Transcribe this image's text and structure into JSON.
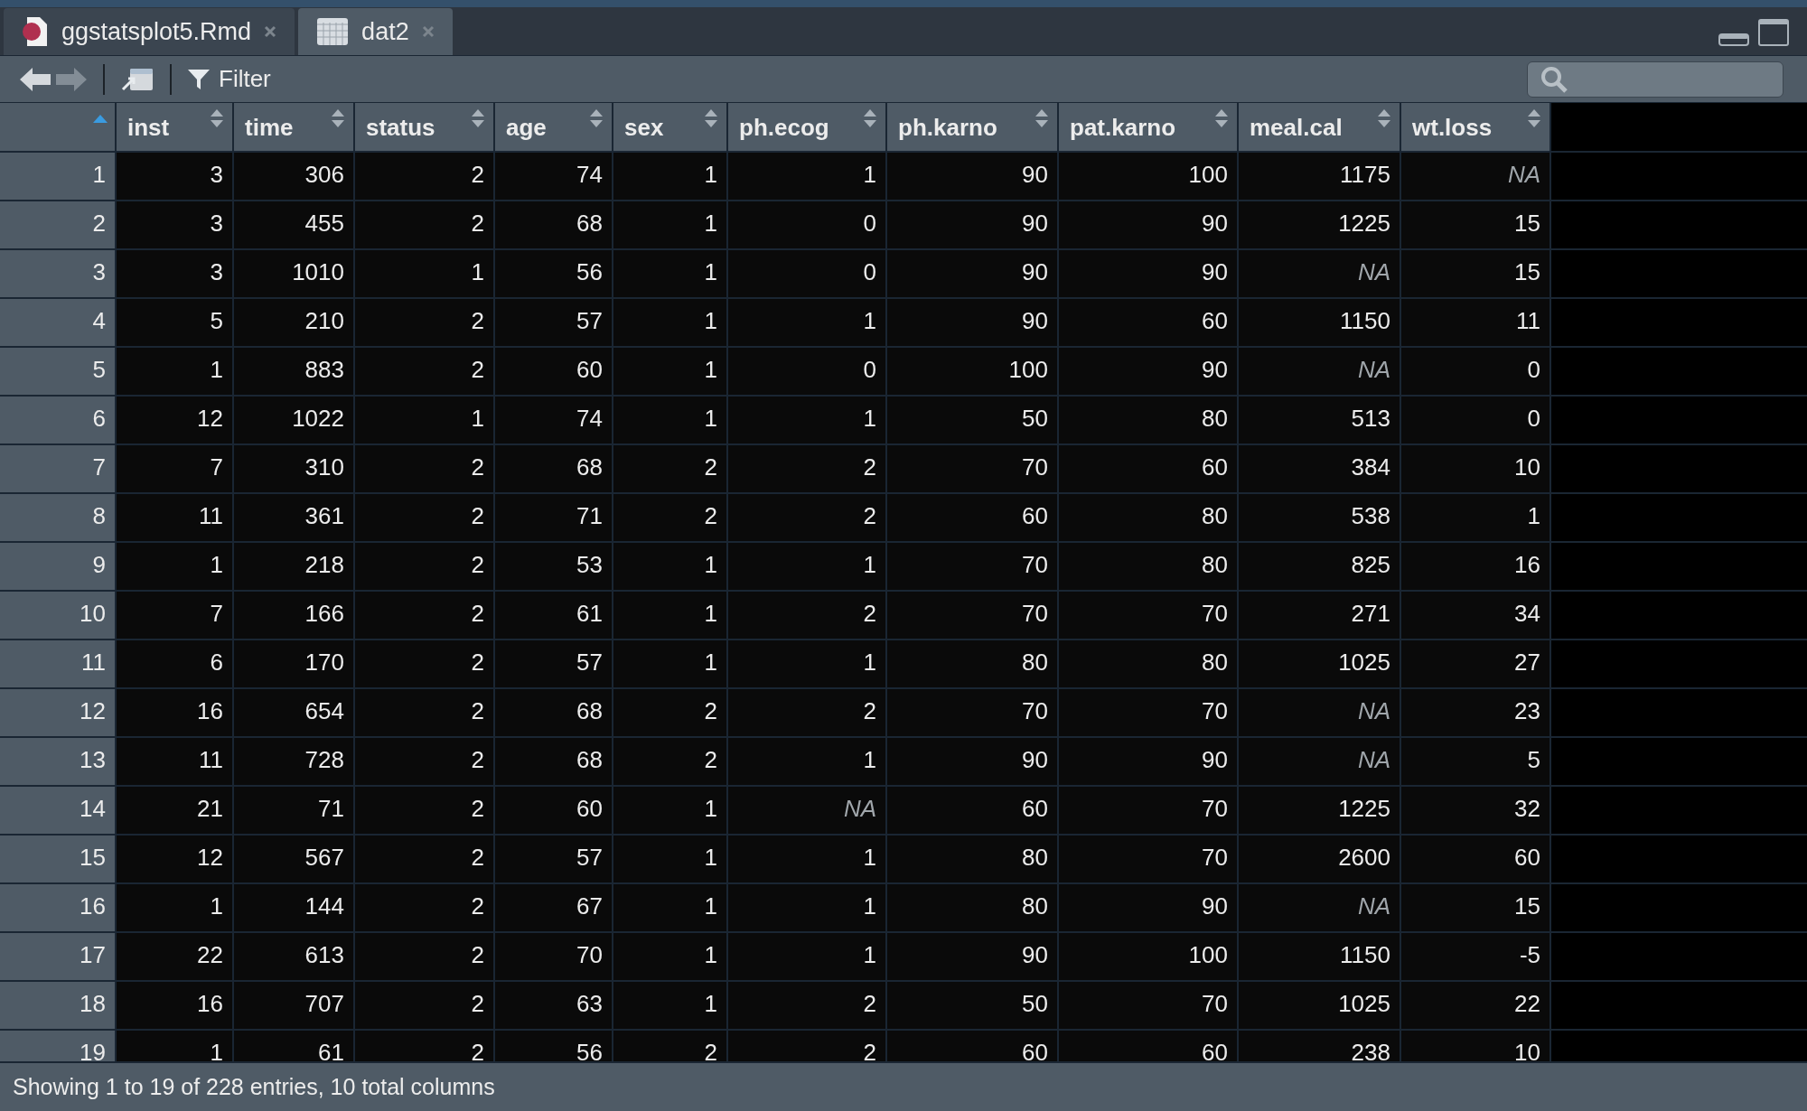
{
  "tabs": [
    {
      "label": "ggstatsplot5.Rmd",
      "kind": "rmd",
      "selected": false
    },
    {
      "label": "dat2",
      "kind": "data",
      "selected": true
    }
  ],
  "toolbar": {
    "filter_label": "Filter"
  },
  "table": {
    "index_header": {
      "sorted": true
    },
    "columns": [
      {
        "label": "inst",
        "sorted": false
      },
      {
        "label": "time",
        "sorted": false
      },
      {
        "label": "status",
        "sorted": false
      },
      {
        "label": "age",
        "sorted": false
      },
      {
        "label": "sex",
        "sorted": false
      },
      {
        "label": "ph.ecog",
        "sorted": false
      },
      {
        "label": "ph.karno",
        "sorted": false
      },
      {
        "label": "pat.karno",
        "sorted": false
      },
      {
        "label": "meal.cal",
        "sorted": false
      },
      {
        "label": "wt.loss",
        "sorted": false
      }
    ],
    "rows": [
      {
        "n": "1",
        "cells": [
          "3",
          "306",
          "2",
          "74",
          "1",
          "1",
          "90",
          "100",
          "1175",
          "NA"
        ],
        "missing": [
          false,
          false,
          false,
          false,
          false,
          false,
          false,
          false,
          false,
          true
        ]
      },
      {
        "n": "2",
        "cells": [
          "3",
          "455",
          "2",
          "68",
          "1",
          "0",
          "90",
          "90",
          "1225",
          "15"
        ],
        "missing": [
          false,
          false,
          false,
          false,
          false,
          false,
          false,
          false,
          false,
          false
        ]
      },
      {
        "n": "3",
        "cells": [
          "3",
          "1010",
          "1",
          "56",
          "1",
          "0",
          "90",
          "90",
          "NA",
          "15"
        ],
        "missing": [
          false,
          false,
          false,
          false,
          false,
          false,
          false,
          false,
          true,
          false
        ]
      },
      {
        "n": "4",
        "cells": [
          "5",
          "210",
          "2",
          "57",
          "1",
          "1",
          "90",
          "60",
          "1150",
          "11"
        ],
        "missing": [
          false,
          false,
          false,
          false,
          false,
          false,
          false,
          false,
          false,
          false
        ]
      },
      {
        "n": "5",
        "cells": [
          "1",
          "883",
          "2",
          "60",
          "1",
          "0",
          "100",
          "90",
          "NA",
          "0"
        ],
        "missing": [
          false,
          false,
          false,
          false,
          false,
          false,
          false,
          false,
          true,
          false
        ]
      },
      {
        "n": "6",
        "cells": [
          "12",
          "1022",
          "1",
          "74",
          "1",
          "1",
          "50",
          "80",
          "513",
          "0"
        ],
        "missing": [
          false,
          false,
          false,
          false,
          false,
          false,
          false,
          false,
          false,
          false
        ]
      },
      {
        "n": "7",
        "cells": [
          "7",
          "310",
          "2",
          "68",
          "2",
          "2",
          "70",
          "60",
          "384",
          "10"
        ],
        "missing": [
          false,
          false,
          false,
          false,
          false,
          false,
          false,
          false,
          false,
          false
        ]
      },
      {
        "n": "8",
        "cells": [
          "11",
          "361",
          "2",
          "71",
          "2",
          "2",
          "60",
          "80",
          "538",
          "1"
        ],
        "missing": [
          false,
          false,
          false,
          false,
          false,
          false,
          false,
          false,
          false,
          false
        ]
      },
      {
        "n": "9",
        "cells": [
          "1",
          "218",
          "2",
          "53",
          "1",
          "1",
          "70",
          "80",
          "825",
          "16"
        ],
        "missing": [
          false,
          false,
          false,
          false,
          false,
          false,
          false,
          false,
          false,
          false
        ]
      },
      {
        "n": "10",
        "cells": [
          "7",
          "166",
          "2",
          "61",
          "1",
          "2",
          "70",
          "70",
          "271",
          "34"
        ],
        "missing": [
          false,
          false,
          false,
          false,
          false,
          false,
          false,
          false,
          false,
          false
        ]
      },
      {
        "n": "11",
        "cells": [
          "6",
          "170",
          "2",
          "57",
          "1",
          "1",
          "80",
          "80",
          "1025",
          "27"
        ],
        "missing": [
          false,
          false,
          false,
          false,
          false,
          false,
          false,
          false,
          false,
          false
        ]
      },
      {
        "n": "12",
        "cells": [
          "16",
          "654",
          "2",
          "68",
          "2",
          "2",
          "70",
          "70",
          "NA",
          "23"
        ],
        "missing": [
          false,
          false,
          false,
          false,
          false,
          false,
          false,
          false,
          true,
          false
        ]
      },
      {
        "n": "13",
        "cells": [
          "11",
          "728",
          "2",
          "68",
          "2",
          "1",
          "90",
          "90",
          "NA",
          "5"
        ],
        "missing": [
          false,
          false,
          false,
          false,
          false,
          false,
          false,
          false,
          true,
          false
        ]
      },
      {
        "n": "14",
        "cells": [
          "21",
          "71",
          "2",
          "60",
          "1",
          "NA",
          "60",
          "70",
          "1225",
          "32"
        ],
        "missing": [
          false,
          false,
          false,
          false,
          false,
          true,
          false,
          false,
          false,
          false
        ]
      },
      {
        "n": "15",
        "cells": [
          "12",
          "567",
          "2",
          "57",
          "1",
          "1",
          "80",
          "70",
          "2600",
          "60"
        ],
        "missing": [
          false,
          false,
          false,
          false,
          false,
          false,
          false,
          false,
          false,
          false
        ]
      },
      {
        "n": "16",
        "cells": [
          "1",
          "144",
          "2",
          "67",
          "1",
          "1",
          "80",
          "90",
          "NA",
          "15"
        ],
        "missing": [
          false,
          false,
          false,
          false,
          false,
          false,
          false,
          false,
          true,
          false
        ]
      },
      {
        "n": "17",
        "cells": [
          "22",
          "613",
          "2",
          "70",
          "1",
          "1",
          "90",
          "100",
          "1150",
          "-5"
        ],
        "missing": [
          false,
          false,
          false,
          false,
          false,
          false,
          false,
          false,
          false,
          false
        ]
      },
      {
        "n": "18",
        "cells": [
          "16",
          "707",
          "2",
          "63",
          "1",
          "2",
          "50",
          "70",
          "1025",
          "22"
        ],
        "missing": [
          false,
          false,
          false,
          false,
          false,
          false,
          false,
          false,
          false,
          false
        ]
      },
      {
        "n": "19",
        "cells": [
          "1",
          "61",
          "2",
          "56",
          "2",
          "2",
          "60",
          "60",
          "238",
          "10"
        ],
        "missing": [
          false,
          false,
          false,
          false,
          false,
          false,
          false,
          false,
          false,
          false
        ]
      }
    ]
  },
  "status_bar": "Showing 1 to 19 of 228 entries, 10 total columns"
}
